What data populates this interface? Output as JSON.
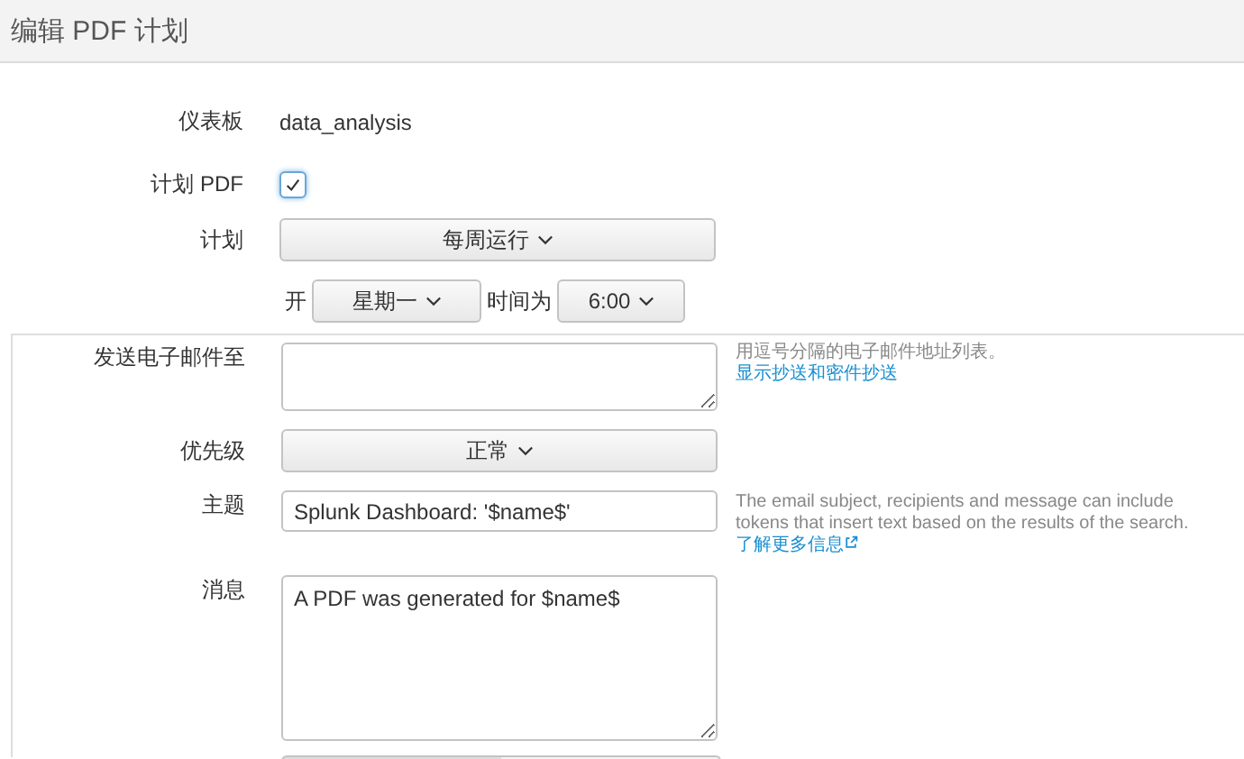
{
  "window": {
    "title": "编辑 PDF 计划"
  },
  "dashboard": {
    "label": "仪表板",
    "value": "data_analysis"
  },
  "schedule_pdf": {
    "label": "计划 PDF",
    "checked": true
  },
  "schedule": {
    "label": "计划",
    "value": "每周运行",
    "on_label": "开",
    "day": "星期一",
    "time_label": "时间为",
    "time": "6:00"
  },
  "email": {
    "label": "发送电子邮件至",
    "help": "用逗号分隔的电子邮件地址列表。",
    "link": "显示抄送和密件抄送"
  },
  "priority": {
    "label": "优先级",
    "value": "正常"
  },
  "subject": {
    "label": "主题",
    "value": "Splunk Dashboard: '$name$'",
    "help": "The email subject, recipients and message can include tokens that insert text based on the results of the search.",
    "link": "了解更多信息"
  },
  "message": {
    "label": "消息",
    "value": "A PDF was generated for $name$"
  }
}
